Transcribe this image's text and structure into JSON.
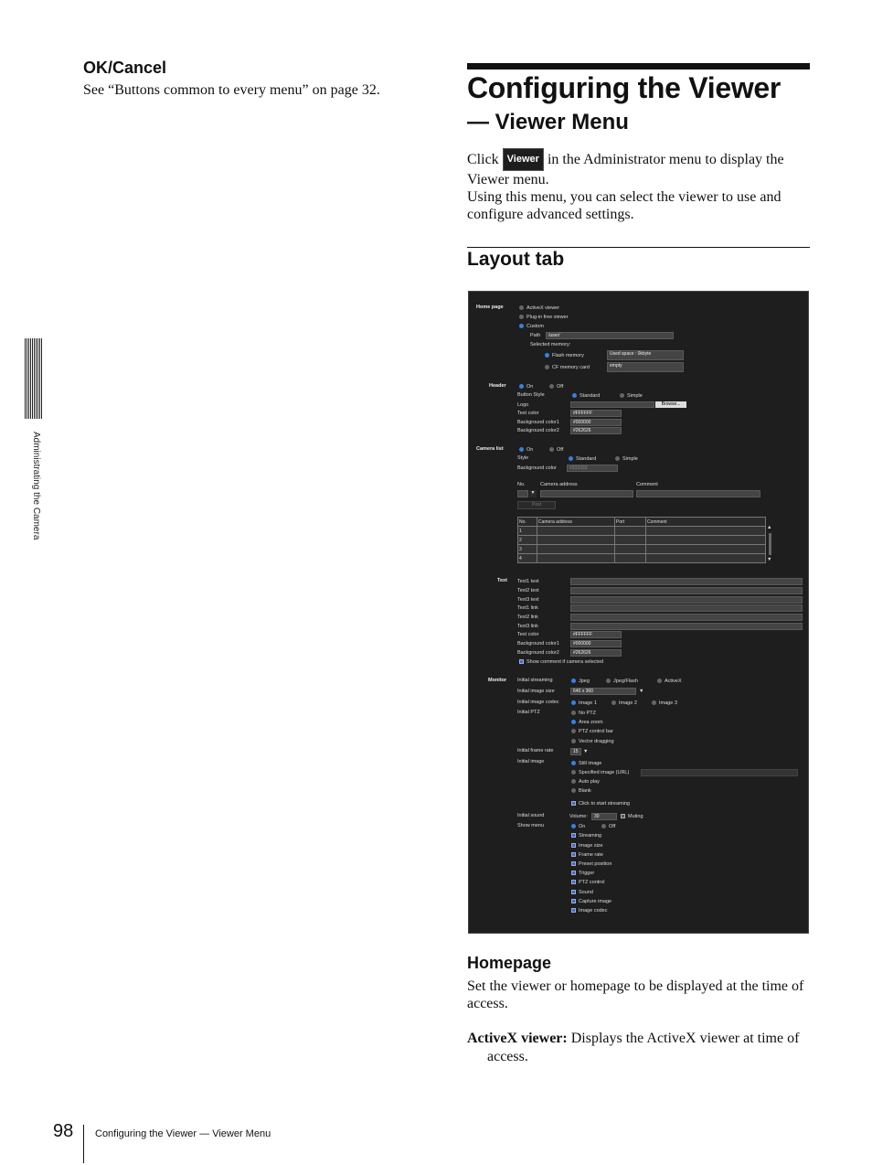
{
  "left": {
    "heading": "OK/Cancel",
    "text": "See “Buttons common to every menu” on page 32."
  },
  "side_tab": "Administrating the Camera",
  "title": "Configuring the Viewer",
  "subtitle": "— Viewer Menu",
  "intro": {
    "click": "Click",
    "button": "Viewer",
    "after_button": "in the Administrator menu to display the Viewer menu.",
    "line2": "Using this menu, you can select the viewer to use and configure advanced settings."
  },
  "section": "Layout tab",
  "screenshot": {
    "homepage": {
      "label": "Home page",
      "options": [
        "ActiveX viewer",
        "Plug-in free viewer",
        "Custom"
      ],
      "path_label": "Path",
      "path_value": "/user/",
      "selected_memory": "Selected memory:",
      "flash": "Flash memory",
      "cf": "CF memory card",
      "used_space": "Used space : 0kbyte",
      "empty": "empty"
    },
    "header": {
      "label": "Header",
      "on": "On",
      "off": "Off",
      "button_style": "Button Style",
      "standard": "Standard",
      "simple": "Simple",
      "logo": "Logo",
      "browse": "Browse...",
      "text_color": "Text color",
      "text_color_val": "#FFFFFF",
      "bg1": "Background color1",
      "bg1_val": "#000000",
      "bg2": "Background color2",
      "bg2_val": "#262626"
    },
    "camera_list": {
      "label": "Camera list",
      "on": "On",
      "off": "Off",
      "style": "Style",
      "standard": "Standard",
      "simple": "Simple",
      "bg": "Background color",
      "bg_val": "#333333",
      "no": "No.",
      "camera_address": "Camera address",
      "comment": "Comment",
      "port": "Port",
      "arrow": "▼",
      "post": "Post",
      "rows": [
        "1",
        "2",
        "3",
        "4"
      ],
      "scroll_up": "▲",
      "scroll_down": "▼"
    },
    "text": {
      "label": "Text",
      "items": [
        "Text1 text",
        "Text2 text",
        "Text3 text",
        "Text1 link",
        "Text2 link",
        "Text3 link"
      ],
      "text_color": "Text color",
      "text_color_val": "#FFFFFF",
      "bg1": "Background color1",
      "bg1_val": "#000000",
      "bg2": "Background color2",
      "bg2_val": "#262626",
      "show_comment": "Show comment if camera selected"
    },
    "monitor": {
      "label": "Monitor",
      "initial_streaming": "Initial streaming",
      "streaming_opts": [
        "Jpeg",
        "Jpeg/Flash",
        "ActiveX"
      ],
      "initial_image_size": "Initial image size",
      "image_size_val": "640 x 360",
      "initial_image_codec": "Initial image codec",
      "codec_opts": [
        "Image 1",
        "Image 2",
        "Image 3"
      ],
      "initial_ptz": "Initial PTZ",
      "ptz_opts": [
        "No PTZ",
        "Area zoom",
        "PTZ control bar",
        "Vector dragging"
      ],
      "initial_frame_rate": "Initial frame rate",
      "frame_rate_val": "15",
      "initial_image": "Initial image",
      "image_opts": [
        "Still image",
        "Specified image (URL)",
        "Auto play",
        "Blank"
      ],
      "click_to_start": "Click to start streaming",
      "initial_sound": "Initial sound",
      "volume": "Volume:",
      "volume_val": "30",
      "muting": "Muting",
      "show_menu": "Show menu",
      "on": "On",
      "off": "Off",
      "menu_items": [
        "Streaming",
        "Image size",
        "Frame rate",
        "Preset position",
        "Trigger",
        "PTZ control",
        "Sound",
        "Capture image",
        "Image codec"
      ]
    }
  },
  "homepage": {
    "heading": "Homepage",
    "text": "Set the viewer or homepage to be displayed at the time of access.",
    "activex_term": "ActiveX viewer:",
    "activex_desc": "Displays the ActiveX viewer at time of access."
  },
  "footer": {
    "page_number": "98",
    "text": "Configuring the Viewer — Viewer Menu"
  }
}
